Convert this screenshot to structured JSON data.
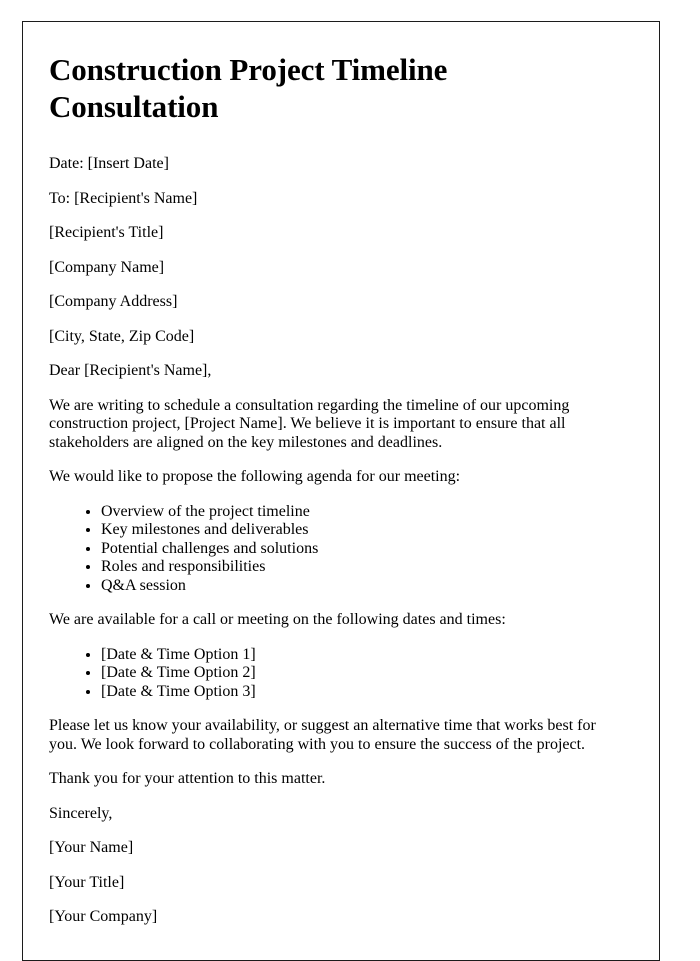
{
  "document": {
    "title": "Construction Project Timeline Consultation",
    "header_lines": [
      "Date: [Insert Date]",
      "To: [Recipient's Name]",
      "[Recipient's Title]",
      "[Company Name]",
      "[Company Address]",
      "[City, State, Zip Code]"
    ],
    "salutation": "Dear [Recipient's Name],",
    "intro_paragraph": "We are writing to schedule a consultation regarding the timeline of our upcoming construction project, [Project Name]. We believe it is important to ensure that all stakeholders are aligned on the key milestones and deadlines.",
    "agenda_intro": "We would like to propose the following agenda for our meeting:",
    "agenda_items": [
      "Overview of the project timeline",
      "Key milestones and deliverables",
      "Potential challenges and solutions",
      "Roles and responsibilities",
      "Q&A session"
    ],
    "availability_intro": "We are available for a call or meeting on the following dates and times:",
    "availability_options": [
      "[Date & Time Option 1]",
      "[Date & Time Option 2]",
      "[Date & Time Option 3]"
    ],
    "closing_paragraph": "Please let us know your availability, or suggest an alternative time that works best for you. We look forward to collaborating with you to ensure the success of the project.",
    "thanks_paragraph": "Thank you for your attention to this matter.",
    "signoff": "Sincerely,",
    "signature_lines": [
      "[Your Name]",
      "[Your Title]",
      "[Your Company]"
    ]
  }
}
